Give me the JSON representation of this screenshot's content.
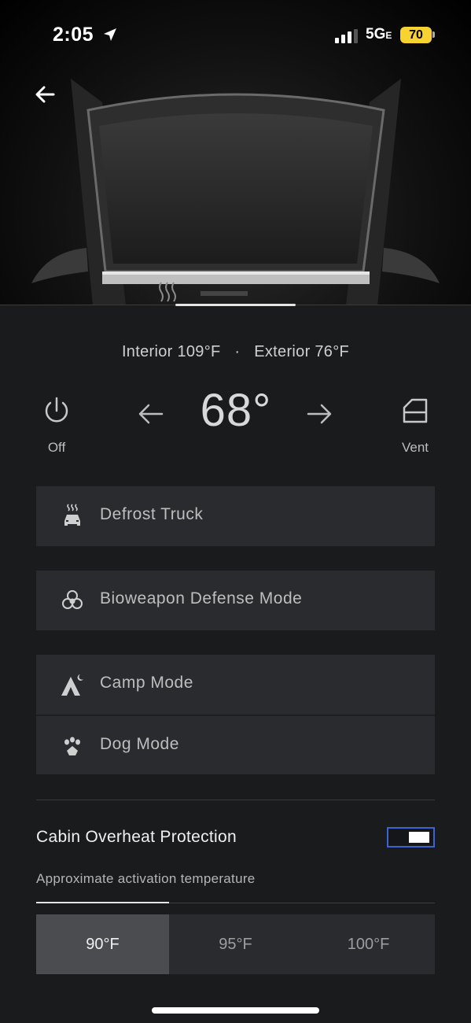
{
  "status_bar": {
    "time": "2:05",
    "network": "5G",
    "network_suffix": "E",
    "battery": "70",
    "battery_color": "#f7d230"
  },
  "header": {
    "back_icon": "arrow-left-icon"
  },
  "climate": {
    "interior": "Interior 109°F",
    "separator": "·",
    "exterior": "Exterior 76°F",
    "set_temp": "68°",
    "power_label": "Off",
    "power_icon": "power-icon",
    "vent_label": "Vent",
    "vent_icon": "window-vent-icon"
  },
  "modes": {
    "defrost": {
      "label": "Defrost Truck",
      "icon": "defrost-car-icon"
    },
    "bioweapon": {
      "label": "Bioweapon Defense Mode",
      "icon": "biohazard-icon"
    },
    "camp": {
      "label": "Camp Mode",
      "icon": "tent-moon-icon"
    },
    "dog": {
      "label": "Dog Mode",
      "icon": "paw-icon"
    }
  },
  "overheat": {
    "title": "Cabin Overheat Protection",
    "enabled": true,
    "toggle_color": "#3d63d1",
    "approx_label": "Approximate activation temperature",
    "options": [
      "90°F",
      "95°F",
      "100°F"
    ],
    "selected": "90°F"
  }
}
